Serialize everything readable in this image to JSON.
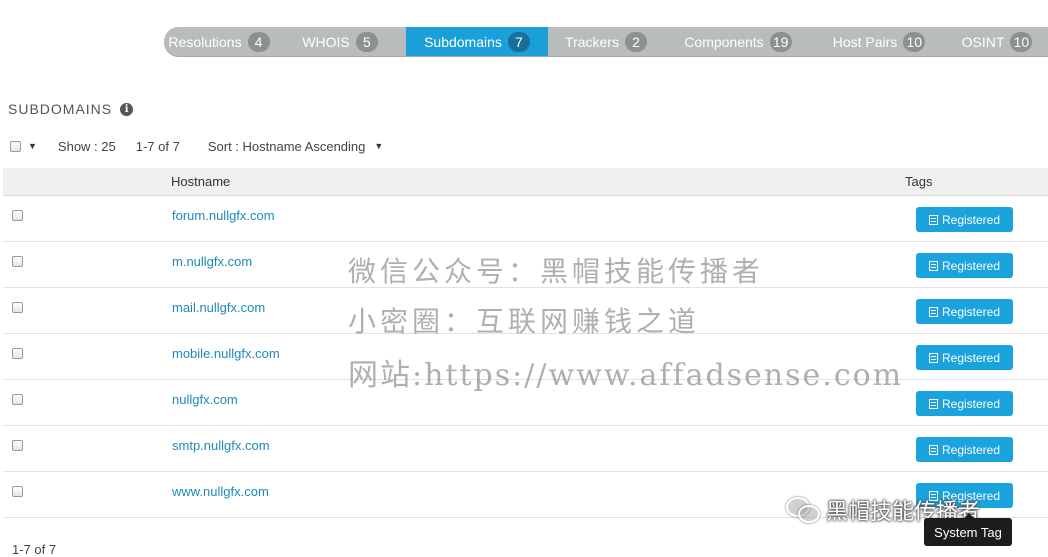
{
  "tabs": [
    {
      "label": "Resolutions",
      "count": "4",
      "active": false
    },
    {
      "label": "WHOIS",
      "count": "5",
      "active": false
    },
    {
      "label": "Subdomains",
      "count": "7",
      "active": true
    },
    {
      "label": "Trackers",
      "count": "2",
      "active": false
    },
    {
      "label": "Components",
      "count": "19",
      "active": false
    },
    {
      "label": "Host Pairs",
      "count": "10",
      "active": false
    },
    {
      "label": "OSINT",
      "count": "10",
      "active": false
    }
  ],
  "section": {
    "title": "SUBDOMAINS",
    "info_icon": "info-icon"
  },
  "toolbar": {
    "show_label": "Show : 25",
    "range_label": "1-7 of 7",
    "sort_label": "Sort : Hostname Ascending"
  },
  "table": {
    "columns": {
      "hostname": "Hostname",
      "tags": "Tags"
    },
    "rows": [
      {
        "hostname": "forum.nullgfx.com",
        "tag": "Registered"
      },
      {
        "hostname": "m.nullgfx.com",
        "tag": "Registered"
      },
      {
        "hostname": "mail.nullgfx.com",
        "tag": "Registered"
      },
      {
        "hostname": "mobile.nullgfx.com",
        "tag": "Registered"
      },
      {
        "hostname": "nullgfx.com",
        "tag": "Registered"
      },
      {
        "hostname": "smtp.nullgfx.com",
        "tag": "Registered"
      },
      {
        "hostname": "www.nullgfx.com",
        "tag": "Registered"
      }
    ]
  },
  "footer": {
    "count": "1-7 of 7"
  },
  "tooltip": {
    "text": "System Tag"
  },
  "watermark": {
    "line1": "微信公众号：黑帽技能传播者",
    "line2": "小密圈：互联网赚钱之道",
    "line3": "网站:https://www.affadsense.com",
    "brand": "黑帽技能传播者"
  },
  "colors": {
    "active_tab": "#1a9fd8",
    "tab_bar": "#b9bcbd",
    "link": "#1e8ab8",
    "tag_button": "#1aa3dc"
  }
}
